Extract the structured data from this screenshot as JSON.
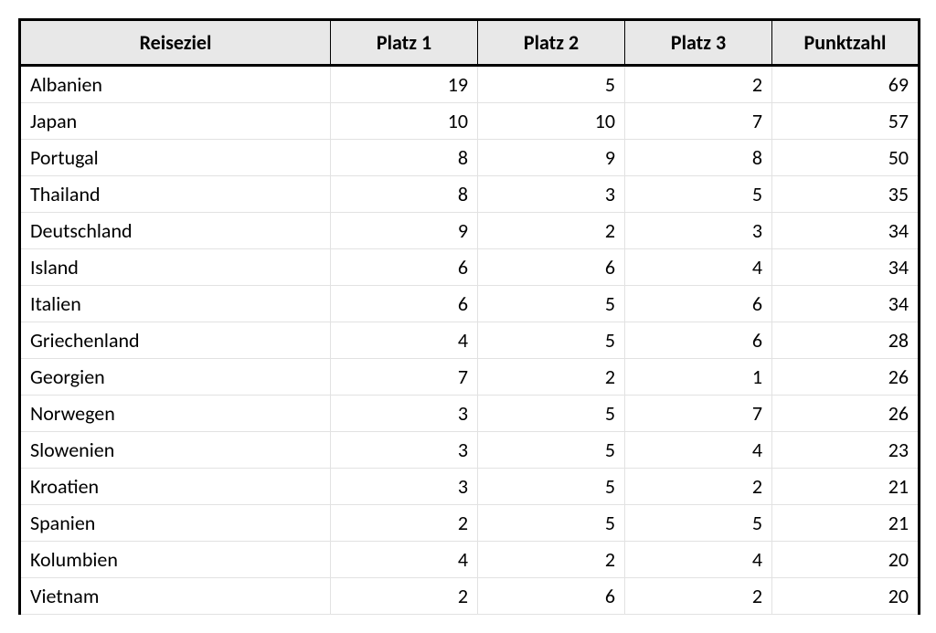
{
  "table": {
    "headers": [
      "Reiseziel",
      "Platz 1",
      "Platz 2",
      "Platz 3",
      "Punktzahl"
    ],
    "rows": [
      {
        "dest": "Albanien",
        "p1": 19,
        "p2": 5,
        "p3": 2,
        "score": 69
      },
      {
        "dest": "Japan",
        "p1": 10,
        "p2": 10,
        "p3": 7,
        "score": 57
      },
      {
        "dest": "Portugal",
        "p1": 8,
        "p2": 9,
        "p3": 8,
        "score": 50
      },
      {
        "dest": "Thailand",
        "p1": 8,
        "p2": 3,
        "p3": 5,
        "score": 35
      },
      {
        "dest": "Deutschland",
        "p1": 9,
        "p2": 2,
        "p3": 3,
        "score": 34
      },
      {
        "dest": "Island",
        "p1": 6,
        "p2": 6,
        "p3": 4,
        "score": 34
      },
      {
        "dest": "Italien",
        "p1": 6,
        "p2": 5,
        "p3": 6,
        "score": 34
      },
      {
        "dest": "Griechenland",
        "p1": 4,
        "p2": 5,
        "p3": 6,
        "score": 28
      },
      {
        "dest": "Georgien",
        "p1": 7,
        "p2": 2,
        "p3": 1,
        "score": 26
      },
      {
        "dest": "Norwegen",
        "p1": 3,
        "p2": 5,
        "p3": 7,
        "score": 26
      },
      {
        "dest": "Slowenien",
        "p1": 3,
        "p2": 5,
        "p3": 4,
        "score": 23
      },
      {
        "dest": "Kroatien",
        "p1": 3,
        "p2": 5,
        "p3": 2,
        "score": 21
      },
      {
        "dest": "Spanien",
        "p1": 2,
        "p2": 5,
        "p3": 5,
        "score": 21
      },
      {
        "dest": "Kolumbien",
        "p1": 4,
        "p2": 2,
        "p3": 4,
        "score": 20
      },
      {
        "dest": "Vietnam",
        "p1": 2,
        "p2": 6,
        "p3": 2,
        "score": 20
      }
    ]
  }
}
